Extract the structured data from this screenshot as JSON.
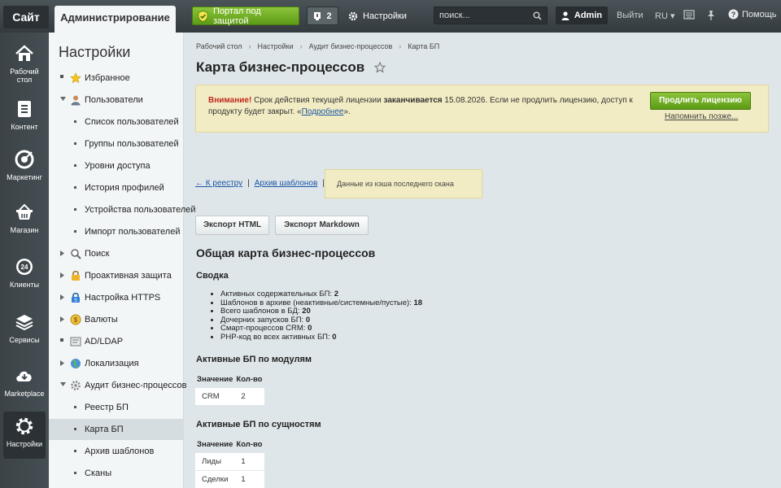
{
  "topbar": {
    "site_label": "Сайт",
    "admin_tab": "Администрирование",
    "portal_label": "Портал под защитой",
    "notif_count": "2",
    "settings_label": "Настройки",
    "search_placeholder": "поиск...",
    "user_name": "Admin",
    "logout_label": "Выйти",
    "lang_label": "RU",
    "help_label": "Помощь"
  },
  "rail": [
    {
      "label": "Рабочий стол",
      "icon": "home-icon"
    },
    {
      "label": "Контент",
      "icon": "document-icon"
    },
    {
      "label": "Маркетинг",
      "icon": "target-icon"
    },
    {
      "label": "Магазин",
      "icon": "basket-icon"
    },
    {
      "label": "Клиенты",
      "icon": "clock-24-icon"
    },
    {
      "label": "Сервисы",
      "icon": "layers-icon"
    },
    {
      "label": "Marketplace",
      "icon": "cloud-download-icon"
    },
    {
      "label": "Настройки",
      "icon": "gear-icon"
    }
  ],
  "sidebar": {
    "title": "Настройки",
    "items": [
      {
        "label": "Избранное",
        "icon": "star-icon"
      },
      {
        "label": "Пользователи",
        "icon": "user-icon"
      },
      {
        "label": "Список пользователей"
      },
      {
        "label": "Группы пользователей"
      },
      {
        "label": "Уровни доступа"
      },
      {
        "label": "История профилей"
      },
      {
        "label": "Устройства пользователей"
      },
      {
        "label": "Импорт пользователей"
      },
      {
        "label": "Поиск",
        "icon": "magnifier-icon"
      },
      {
        "label": "Проактивная защита",
        "icon": "lock-icon"
      },
      {
        "label": "Настройка HTTPS",
        "icon": "https-lock-icon"
      },
      {
        "label": "Валюты",
        "icon": "coin-icon"
      },
      {
        "label": "AD/LDAP",
        "icon": "ldap-icon"
      },
      {
        "label": "Локализация",
        "icon": "globe-icon"
      },
      {
        "label": "Аудит бизнес-процессов",
        "icon": "audit-gear-icon"
      },
      {
        "label": "Реестр БП"
      },
      {
        "label": "Карта БП"
      },
      {
        "label": "Архив шаблонов"
      },
      {
        "label": "Сканы"
      }
    ]
  },
  "breadcrumbs": [
    "Рабочий стол",
    "Настройки",
    "Аудит бизнес-процессов",
    "Карта БП"
  ],
  "page_title": "Карта бизнес-процессов",
  "notice": {
    "warn": "Внимание!",
    "text1": " Срок действия текущей лицензии ",
    "bold": "заканчивается",
    "text2": " 15.08.2026. Если не продлить лицензию, доступ к продукту будет закрыт. «",
    "link": "Подробнее",
    "text3": "».",
    "button": "Продлить лицензию",
    "remind": "Напомнить позже..."
  },
  "links": {
    "back": "← К реестру",
    "archive": "Архив шаблонов",
    "sep": "|"
  },
  "cache_note": "Данные из кэша последнего скана",
  "buttons": {
    "export_html": "Экспорт HTML",
    "export_md": "Экспорт Markdown"
  },
  "section_title": "Общая карта бизнес-процессов",
  "summary": {
    "title": "Сводка",
    "items": [
      {
        "label": "Активных содержательных БП: ",
        "value": "2"
      },
      {
        "label": "Шаблонов в архиве (неактивные/системные/пустые): ",
        "value": "18"
      },
      {
        "label": "Всего шаблонов в БД: ",
        "value": "20"
      },
      {
        "label": "Дочерних запусков БП: ",
        "value": "0"
      },
      {
        "label": "Смарт-процессов CRM: ",
        "value": "0"
      },
      {
        "label": "PHP-код во всех активных БП: ",
        "value": "0"
      }
    ]
  },
  "by_module": {
    "title": "Активные БП по модулям",
    "headers": [
      "Значение",
      "Кол-во"
    ],
    "rows": [
      [
        "CRM",
        "2"
      ]
    ]
  },
  "by_entity": {
    "title": "Активные БП по сущностям",
    "headers": [
      "Значение",
      "Кол-во"
    ],
    "rows": [
      [
        "Лиды",
        "1"
      ],
      [
        "Сделки",
        "1"
      ]
    ]
  }
}
